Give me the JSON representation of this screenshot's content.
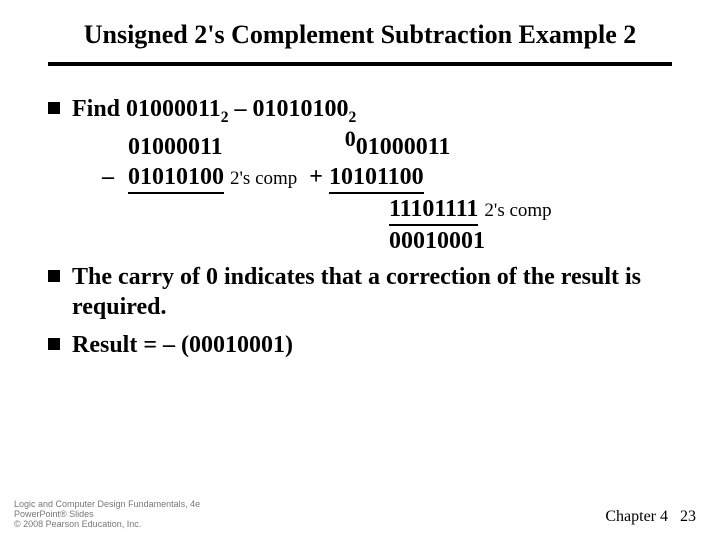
{
  "title": "Unsigned 2's Complement Subtraction Example 2",
  "find": {
    "prefix": "Find ",
    "a": "01000011",
    "sub_a": "2",
    "dash": " – ",
    "b": "01010100",
    "sub_b": "2"
  },
  "math": {
    "left_top": "01000011",
    "left_minus": "–",
    "left_bot": "01010100",
    "note_2c": "2's comp",
    "carry0": "0",
    "right_top": "01000011",
    "right_plus": "+",
    "right_bot": "10101100",
    "right_sum": "11101111",
    "note_2c_r": "2's comp",
    "right_res": "00010001"
  },
  "bullet2": "The carry of 0 indicates that a correction of the result is required.",
  "bullet3_prefix": "Result = – (",
  "bullet3_val": "00010001",
  "bullet3_suffix": ")",
  "footer": {
    "left1": "Logic and Computer Design Fundamentals, 4e",
    "left2": "PowerPoint® Slides",
    "left3": "© 2008 Pearson Education, Inc.",
    "chapter": "Chapter 4",
    "page": "23"
  }
}
